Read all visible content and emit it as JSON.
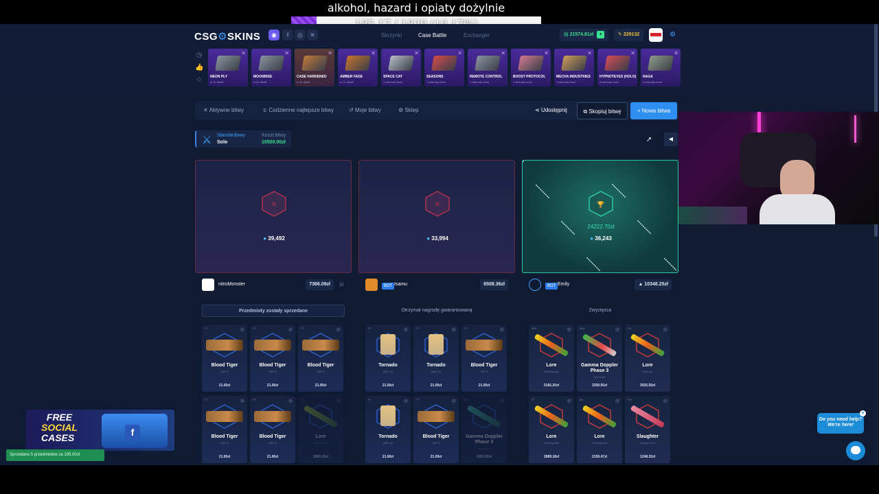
{
  "overlay": {
    "title": "alkohol, hazard i opiaty dożylnie",
    "progress_text": "185.17 / 1820 (10.17%)",
    "progress_fraction": 0.1017
  },
  "header": {
    "logo_left": "CSG",
    "logo_right": "SKINS",
    "tabs": [
      "Skrzynki",
      "Case Battle",
      "Exchanger"
    ],
    "active_tab": "Case Battle",
    "balance": "21574.81zł",
    "points": "229132",
    "colors": {
      "accent": "#2f8ff0",
      "balance": "#3be38f",
      "points": "#f0c23b"
    }
  },
  "cases": [
    {
      "name": "NEON PLY",
      "sub": "w 1h dłuoff"
    },
    {
      "name": "MOONRISE",
      "sub": "w 1h dłuoff"
    },
    {
      "name": "CASE HARDENED",
      "sub": "w 1h dłuoff"
    },
    {
      "name": "AMBER FADE",
      "sub": "w 1h dłuoff"
    },
    {
      "name": "SPACE CAT",
      "sub": "1 sekundy temu"
    },
    {
      "name": "SEASONS",
      "sub": "1 sekundy temu"
    },
    {
      "name": "REMOTE CONTROL",
      "sub": "1 sekundy temu"
    },
    {
      "name": "BOOST PROTOCOL",
      "sub": "1 sekundy temu"
    },
    {
      "name": "MECHA INDUSTRIES",
      "sub": "1 sekundy temu"
    },
    {
      "name": "HYPNOTEYES (HOLO)",
      "sub": "5 sekundy temu"
    },
    {
      "name": "NAGA",
      "sub": "5 sekundy temu"
    }
  ],
  "battle_nav": {
    "active": "Aktywne bitwy",
    "daily": "Codzienne najlepsze bitwy",
    "mine": "Moje bitwy",
    "shop": "Sklep",
    "share": "Udostępnij",
    "copy": "Skopiuj bitwę",
    "new": "+ Nowa bitwa"
  },
  "mode": {
    "type": "Standardowy",
    "sub": "Solo",
    "cost_label": "Koszt bitwy",
    "cost": "10500.00zł"
  },
  "players": [
    {
      "name": "nitroMonster",
      "bot": false,
      "value": "7366.09zł",
      "tokens": "39,492",
      "result": "lose",
      "status": "Przedmioty zostały sprzedane",
      "items": [
        {
          "q": "FT",
          "name": "Blood Tiger",
          "sub": "USP-S",
          "price": "21.00zł",
          "kind": "pistol"
        },
        {
          "q": "FT",
          "name": "Blood Tiger",
          "sub": "USP-S",
          "price": "21.00zł",
          "kind": "pistol"
        },
        {
          "q": "FT",
          "name": "Blood Tiger",
          "sub": "USP-S",
          "price": "21.00zł",
          "kind": "pistol"
        },
        {
          "q": "FT",
          "name": "Blood Tiger",
          "sub": "USP-S",
          "price": "21.00zł",
          "kind": "pistol"
        },
        {
          "q": "FT",
          "name": "Blood Tiger",
          "sub": "USP-S",
          "price": "21.00zł",
          "kind": "pistol"
        },
        {
          "q": "FT",
          "name": "Lore",
          "sub": "M9 Bayonet",
          "price": "2889.18zł",
          "kind": "knife-dim"
        }
      ]
    },
    {
      "name": "Isamu",
      "bot": true,
      "value": "6508.36zł",
      "tokens": "33,994",
      "result": "lose",
      "status": "Otrzymał nagrodę gwarantowaną",
      "items": [
        {
          "q": "FT",
          "name": "Tornado",
          "sub": "MAC-10",
          "price": "21.00zł",
          "kind": "smg"
        },
        {
          "q": "FT",
          "name": "Tornado",
          "sub": "MAC-10",
          "price": "21.00zł",
          "kind": "smg"
        },
        {
          "q": "FT",
          "name": "Blood Tiger",
          "sub": "USP-S",
          "price": "21.00zł",
          "kind": "pistol"
        },
        {
          "q": "FT",
          "name": "Tornado",
          "sub": "MAC-10",
          "price": "21.00zł",
          "kind": "smg"
        },
        {
          "q": "FT",
          "name": "Blood Tiger",
          "sub": "USP-S",
          "price": "21.00zł",
          "kind": "pistol"
        },
        {
          "q": "MW",
          "name": "Gamma Doppler Phase 3",
          "sub": "Gut Knife",
          "price": "3350.05zł",
          "kind": "gk-dim"
        }
      ]
    },
    {
      "name": "Emily",
      "bot": true,
      "value": "10348.25zł",
      "tokens": "36,243",
      "result": "win",
      "prize": "24222.70zł",
      "status": "Zwycięzca",
      "items": [
        {
          "q": "MW",
          "name": "Lore",
          "sub": "M9 Bayonet",
          "price": "5181.20zł",
          "kind": "knife"
        },
        {
          "q": "MW",
          "name": "Gamma Doppler Phase 3",
          "sub": "Gut Knife",
          "price": "3350.05zł",
          "kind": "gk"
        },
        {
          "q": "FN",
          "name": "Lore",
          "sub": "Bayonet",
          "price": "2925.59zł",
          "kind": "knife"
        },
        {
          "q": "FT",
          "name": "Lore",
          "sub": "M9 Bayonet",
          "price": "2889.18zł",
          "kind": "knife"
        },
        {
          "q": "BS",
          "name": "Lore",
          "sub": "M9 Bayonet",
          "price": "2159.47zł",
          "kind": "knife"
        },
        {
          "q": "FN",
          "name": "Slaughter",
          "sub": "Classic Knife",
          "price": "1248.32zł",
          "kind": "slaughter"
        }
      ]
    }
  ],
  "ad": {
    "line1": "FREE",
    "line2": "SOCIAL",
    "line3": "CASES"
  },
  "toast": "Sprzedano 5 przedmiotów za 105.00zł",
  "help": {
    "line1": "Do you need help?",
    "line2": "We're here!"
  }
}
